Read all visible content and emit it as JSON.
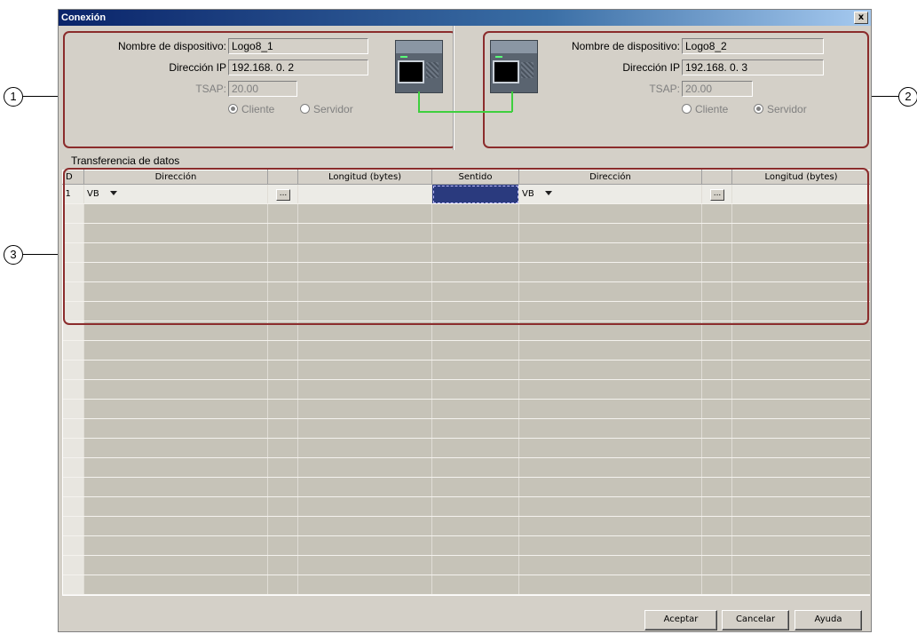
{
  "dialog": {
    "title": "Conexión",
    "close_label": "x"
  },
  "callouts": [
    "1",
    "2",
    "3"
  ],
  "device_left": {
    "name_label": "Nombre de dispositivo:",
    "name_value": "Logo8_1",
    "ip_label": "Dirección IP",
    "ip_value": "192.168.  0.  2",
    "tsap_label": "TSAP:",
    "tsap_value": "20.00",
    "radio_client": "Cliente",
    "radio_server": "Servidor",
    "selected_role": "Cliente"
  },
  "device_right": {
    "name_label": "Nombre de dispositivo:",
    "name_value": "Logo8_2",
    "ip_label": "Dirección IP",
    "ip_value": "192.168.  0.  3",
    "tsap_label": "TSAP:",
    "tsap_value": "20.00",
    "radio_client": "Cliente",
    "radio_server": "Servidor",
    "selected_role": "Servidor"
  },
  "transfer": {
    "section_label": "Transferencia de datos",
    "columns": [
      "ID",
      "Dirección",
      "",
      "Longitud (bytes)",
      "Sentido",
      "Dirección",
      "",
      "Longitud (bytes)"
    ],
    "rows": [
      {
        "id": "1",
        "dir1": "VB",
        "len1": "",
        "sentido": "",
        "dir2": "VB",
        "len2": ""
      }
    ],
    "browse_label": "..."
  },
  "buttons": {
    "ok": "Aceptar",
    "cancel": "Cancelar",
    "help": "Ayuda"
  }
}
